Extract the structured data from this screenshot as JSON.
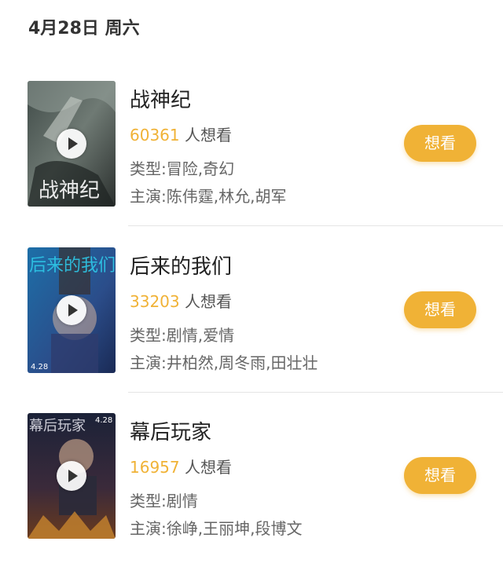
{
  "header": {
    "date": "4月28日 周六"
  },
  "movies": [
    {
      "title": "战神纪",
      "wish_count": "60361",
      "wish_suffix": " 人想看",
      "genre": "类型:冒险,奇幻",
      "cast": "主演:陈伟霆,林允,胡军",
      "button": "想看"
    },
    {
      "title": "后来的我们",
      "wish_count": "33203",
      "wish_suffix": " 人想看",
      "genre": "类型:剧情,爱情",
      "cast": "主演:井柏然,周冬雨,田壮壮",
      "button": "想看"
    },
    {
      "title": "幕后玩家",
      "wish_count": "16957",
      "wish_suffix": " 人想看",
      "genre": "类型:剧情",
      "cast": "主演:徐峥,王丽坤,段博文",
      "button": "想看"
    }
  ],
  "posters": [
    {
      "text": "战神纪"
    },
    {
      "text": "后来的我们"
    },
    {
      "text": "幕后玩家"
    }
  ],
  "colors": {
    "accent": "#f0b236"
  }
}
